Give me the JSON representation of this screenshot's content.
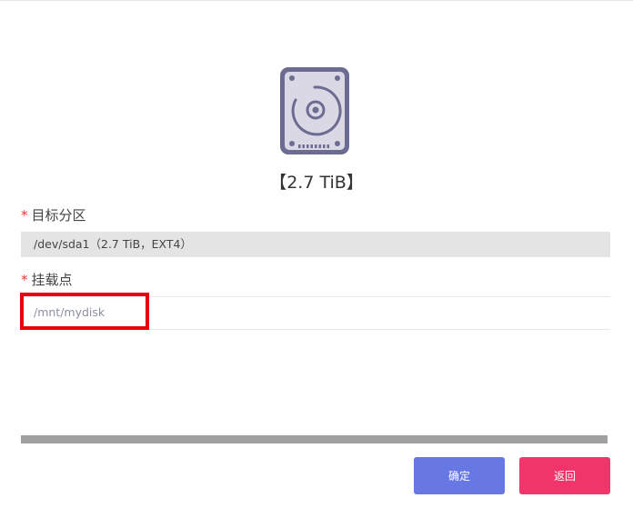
{
  "disk": {
    "icon": "hard-disk-icon",
    "size_label": "【2.7 TiB】"
  },
  "form": {
    "target_partition": {
      "required_mark": "*",
      "label": "目标分区",
      "value": "/dev/sda1（2.7 TiB，EXT4）"
    },
    "mount_point": {
      "required_mark": "*",
      "label": "挂载点",
      "placeholder": "/mnt/mydisk",
      "value": ""
    }
  },
  "progress": {
    "fraction": 1.0
  },
  "actions": {
    "confirm_label": "确定",
    "back_label": "返回"
  },
  "colors": {
    "confirm": "#6777e3",
    "back": "#f0356a",
    "highlight": "#e8000b",
    "required": "#e53935"
  }
}
